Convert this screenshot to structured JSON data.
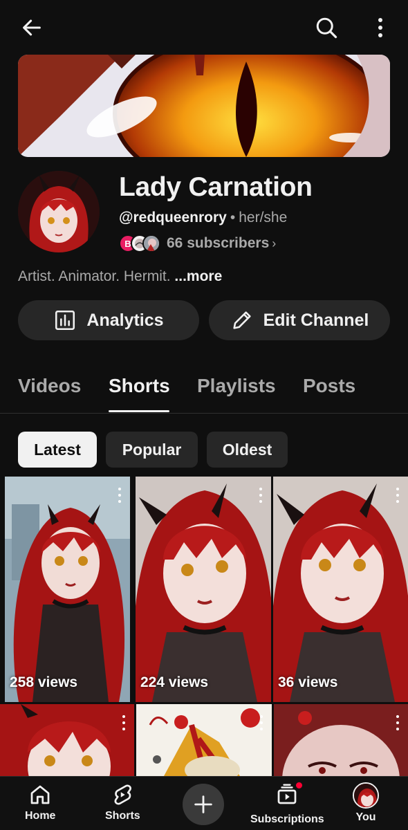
{
  "topbar": {
    "back_icon": "arrow-left-icon",
    "search_icon": "search-icon",
    "more_icon": "more-vertical-icon"
  },
  "channel": {
    "name": "Lady Carnation",
    "handle": "@redqueenrory",
    "separator": "•",
    "pronouns": "her/she",
    "subscriber_avatar_letter": "B",
    "subscribers_text": "66 subscribers",
    "subscribers_chevron": "›",
    "description": "Artist. Animator. Hermit.",
    "more_label": "...more"
  },
  "actions": {
    "analytics_label": "Analytics",
    "edit_label": "Edit Channel"
  },
  "tabs": [
    {
      "label": "Videos",
      "active": false
    },
    {
      "label": "Shorts",
      "active": true
    },
    {
      "label": "Playlists",
      "active": false
    },
    {
      "label": "Posts",
      "active": false
    }
  ],
  "chips": [
    {
      "label": "Latest",
      "active": true
    },
    {
      "label": "Popular",
      "active": false
    },
    {
      "label": "Oldest",
      "active": false
    }
  ],
  "shorts": [
    {
      "views": "258 views"
    },
    {
      "views": "224 views"
    },
    {
      "views": "36 views"
    },
    {
      "views": ""
    },
    {
      "views": ""
    },
    {
      "views": ""
    }
  ],
  "bottom_nav": {
    "home": "Home",
    "shorts": "Shorts",
    "create_icon": "plus-icon",
    "subscriptions": "Subscriptions",
    "you": "You"
  },
  "colors": {
    "background": "#0f0f0f",
    "surface": "#272727",
    "text_primary": "#f1f1f1",
    "text_secondary": "#aaaaaa",
    "accent_red": "#ff0033",
    "avatar_pink": "#e91e63"
  }
}
